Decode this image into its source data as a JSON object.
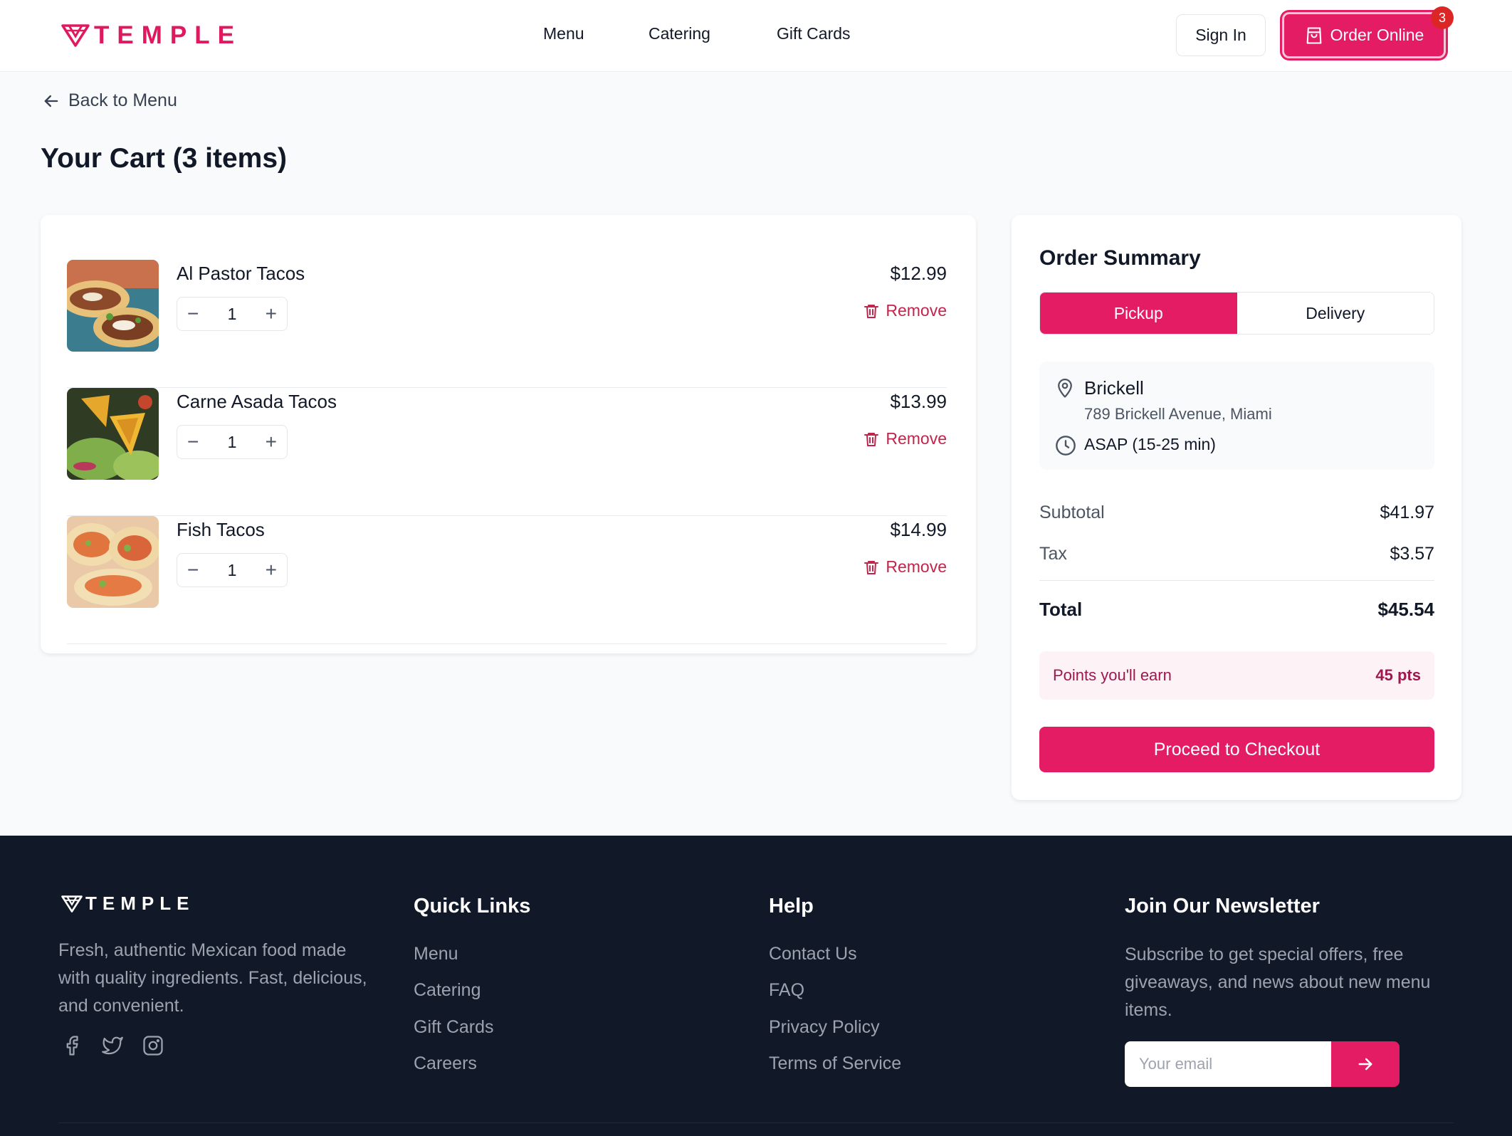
{
  "header": {
    "brand": "TEMPLE",
    "nav": [
      {
        "label": "Menu"
      },
      {
        "label": "Catering"
      },
      {
        "label": "Gift Cards"
      }
    ],
    "sign_in_label": "Sign In",
    "order_online_label": "Order Online",
    "cart_count": "3"
  },
  "back_link_label": "Back to Menu",
  "page_title": "Your Cart (3 items)",
  "cart": {
    "items": [
      {
        "name": "Al Pastor Tacos",
        "quantity": "1",
        "price": "$12.99",
        "remove_label": "Remove"
      },
      {
        "name": "Carne Asada Tacos",
        "quantity": "1",
        "price": "$13.99",
        "remove_label": "Remove"
      },
      {
        "name": "Fish Tacos",
        "quantity": "1",
        "price": "$14.99",
        "remove_label": "Remove"
      }
    ]
  },
  "summary": {
    "title": "Order Summary",
    "modes": [
      {
        "label": "Pickup",
        "selected": true
      },
      {
        "label": "Delivery",
        "selected": false
      }
    ],
    "location_name": "Brickell",
    "location_address": "789 Brickell Avenue, Miami",
    "pickup_time": "ASAP (15-25 min)",
    "subtotal_label": "Subtotal",
    "subtotal_value": "$41.97",
    "tax_label": "Tax",
    "tax_value": "$3.57",
    "total_label": "Total",
    "total_value": "$45.54",
    "points_label": "Points you'll earn",
    "points_value": "45 pts",
    "checkout_label": "Proceed to Checkout"
  },
  "footer": {
    "brand": "TEMPLE",
    "description": "Fresh, authentic Mexican food made with quality ingredients. Fast, delicious, and convenient.",
    "quick_links_title": "Quick Links",
    "quick_links": [
      {
        "label": "Menu"
      },
      {
        "label": "Catering"
      },
      {
        "label": "Gift Cards"
      },
      {
        "label": "Careers"
      }
    ],
    "help_title": "Help",
    "help_links": [
      {
        "label": "Contact Us"
      },
      {
        "label": "FAQ"
      },
      {
        "label": "Privacy Policy"
      },
      {
        "label": "Terms of Service"
      }
    ],
    "newsletter_title": "Join Our Newsletter",
    "newsletter_desc": "Subscribe to get special offers, free giveaways, and news about new menu items.",
    "email_placeholder": "Your email"
  },
  "colors": {
    "brand": "#e31c63",
    "remove": "#c0264b",
    "footer_bg": "#111827"
  }
}
